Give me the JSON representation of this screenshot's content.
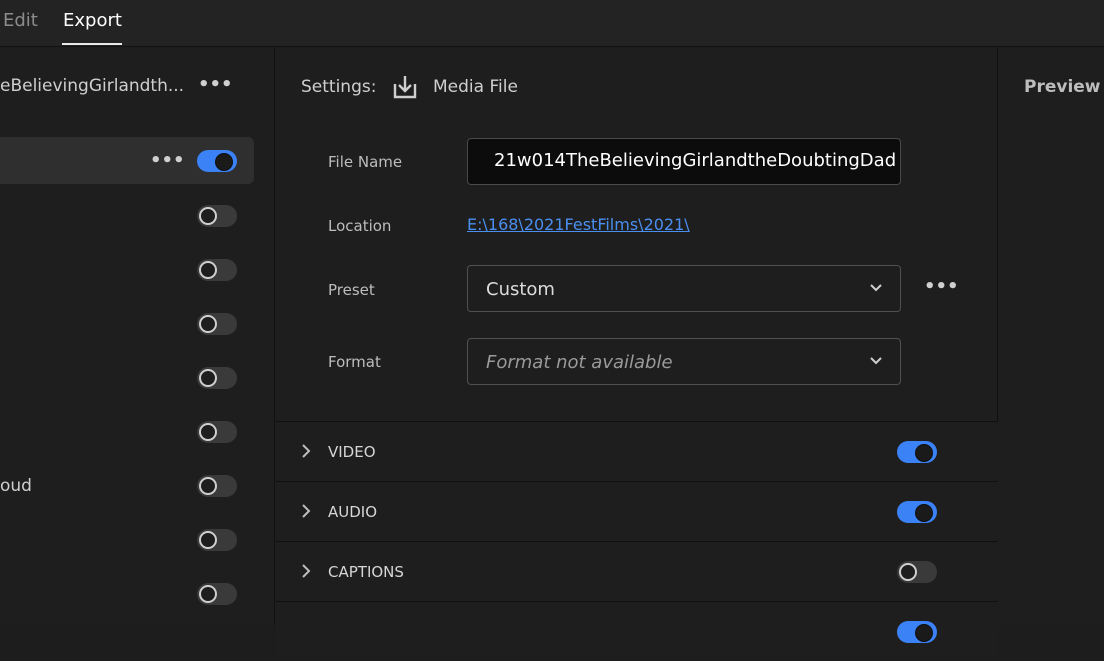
{
  "tabs": {
    "edit": "Edit",
    "export": "Export"
  },
  "left_panel": {
    "title": "eBelievingGirlandth...",
    "more_dots": "•••",
    "selected_row_dots": "•••",
    "row_label_partial": "oud",
    "toggles": [
      "on",
      "off",
      "off",
      "off",
      "off",
      "off",
      "off",
      "off",
      "off"
    ]
  },
  "settings": {
    "label": "Settings:",
    "media_label": "Media File",
    "file_name_label": "File Name",
    "file_name_value": "21w014TheBelievingGirlandtheDoubtingDad",
    "location_label": "Location",
    "location_value": "E:\\168\\2021FestFilms\\2021\\",
    "preset_label": "Preset",
    "preset_value": "Custom",
    "preset_dots": "•••",
    "format_label": "Format",
    "format_placeholder": "Format not available"
  },
  "sections": [
    {
      "label": "VIDEO",
      "toggle": "on"
    },
    {
      "label": "AUDIO",
      "toggle": "on"
    },
    {
      "label": "CAPTIONS",
      "toggle": "off"
    }
  ],
  "preview": {
    "label": "Preview"
  },
  "colors": {
    "accent": "#3b82f6",
    "link": "#4a8ff0",
    "background": "#1e1e1e"
  }
}
